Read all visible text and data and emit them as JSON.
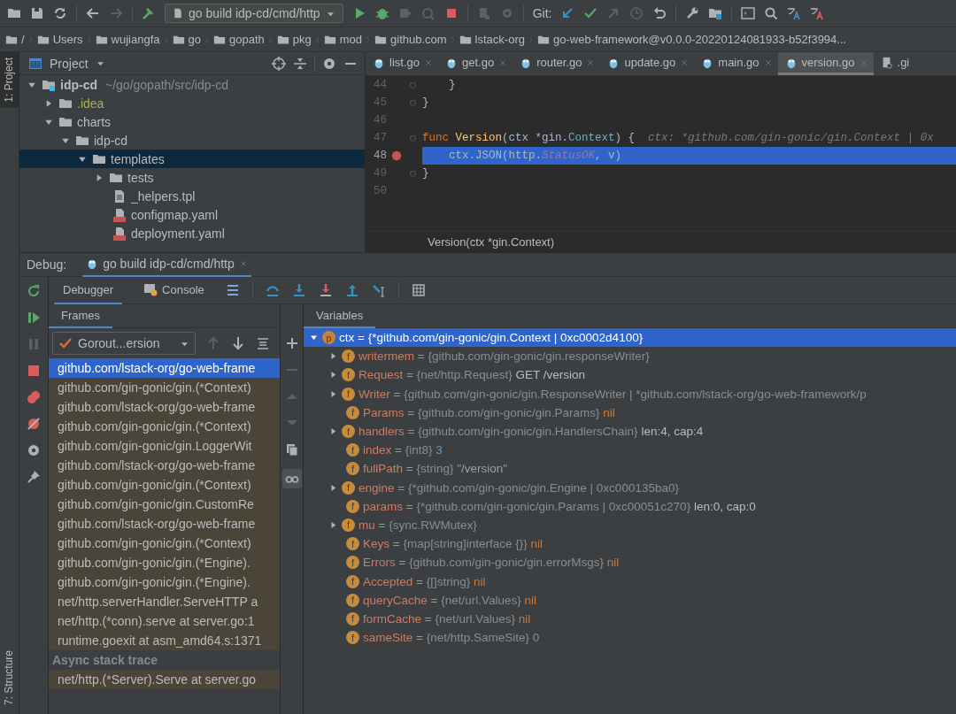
{
  "toolbar": {
    "run_config": "go build idp-cd/cmd/http",
    "git_label": "Git:"
  },
  "breadcrumbs": [
    "/",
    "Users",
    "wujiangfa",
    "go",
    "gopath",
    "pkg",
    "mod",
    "github.com",
    "lstack-org",
    "go-web-framework@v0.0.0-20220124081933-b52f3994..."
  ],
  "tool_strip": {
    "top": "1: Project",
    "bottom": "7: Structure"
  },
  "project": {
    "title": "Project",
    "tree": [
      {
        "name": "idp-cd",
        "hint": "~/go/gopath/src/idp-cd",
        "kind": "module",
        "expanded": true,
        "selected": false,
        "children": [
          {
            "name": ".idea",
            "kind": "folder",
            "expanded": false,
            "selected": false,
            "vcs_ignored": true
          },
          {
            "name": "charts",
            "kind": "folder",
            "expanded": true,
            "selected": false,
            "children": [
              {
                "name": "idp-cd",
                "kind": "folder",
                "expanded": true,
                "selected": false,
                "children": [
                  {
                    "name": "templates",
                    "kind": "folder",
                    "expanded": true,
                    "selected": true,
                    "children": [
                      {
                        "name": "tests",
                        "kind": "folder",
                        "expanded": false,
                        "selected": false
                      },
                      {
                        "name": "_helpers.tpl",
                        "kind": "file",
                        "selected": false
                      },
                      {
                        "name": "configmap.yaml",
                        "kind": "yaml",
                        "selected": false
                      },
                      {
                        "name": "deployment.yaml",
                        "kind": "yaml",
                        "selected": false
                      }
                    ]
                  }
                ]
              }
            ]
          }
        ]
      }
    ]
  },
  "editor": {
    "tabs": [
      {
        "label": "list.go",
        "selected": false
      },
      {
        "label": "get.go",
        "selected": false
      },
      {
        "label": "router.go",
        "selected": false
      },
      {
        "label": "update.go",
        "selected": false
      },
      {
        "label": "main.go",
        "selected": false
      },
      {
        "label": "version.go",
        "selected": true
      },
      {
        "label": ".gi",
        "selected": false,
        "kind": "git"
      }
    ],
    "lines": [
      {
        "number": "44",
        "breakpoint": false,
        "current": false,
        "fold": true,
        "tokens": [
          {
            "text": "    }",
            "kind": "plain"
          }
        ]
      },
      {
        "number": "45",
        "breakpoint": false,
        "current": false,
        "fold": true,
        "tokens": [
          {
            "text": "}",
            "kind": "plain"
          }
        ]
      },
      {
        "number": "46",
        "breakpoint": false,
        "current": false,
        "fold": false
      },
      {
        "number": "47",
        "breakpoint": false,
        "current": false,
        "fold": true,
        "tokens": [
          {
            "text": "func ",
            "kind": "keyword"
          },
          {
            "text": "Version",
            "kind": "function"
          },
          {
            "text": "(ctx *gin.",
            "kind": "plain"
          },
          {
            "text": "Context",
            "kind": "type"
          },
          {
            "text": ") {  ",
            "kind": "plain"
          },
          {
            "text": "ctx: *github.com/gin-gonic/gin.Context | 0x",
            "kind": "hint"
          }
        ]
      },
      {
        "number": "48",
        "breakpoint": true,
        "current": true,
        "fold": false,
        "tokens": [
          {
            "text": "    ctx.JSON(http.",
            "kind": "plain"
          },
          {
            "text": "StatusOK",
            "kind": "const"
          },
          {
            "text": ", v)",
            "kind": "plain"
          }
        ]
      },
      {
        "number": "49",
        "breakpoint": false,
        "current": false,
        "fold": true,
        "tokens": [
          {
            "text": "}",
            "kind": "plain"
          }
        ]
      },
      {
        "number": "50",
        "breakpoint": false,
        "current": false,
        "fold": false
      }
    ],
    "breadcrumb": "Version(ctx *gin.Context)"
  },
  "debug": {
    "label": "Debug:",
    "session": "go build idp-cd/cmd/http",
    "tabs": [
      {
        "label": "Debugger",
        "selected": true
      },
      {
        "label": "Console",
        "selected": false
      }
    ],
    "frames": {
      "title": "Frames",
      "goroutine": "Gorout...ersion",
      "items": [
        {
          "text": "github.com/lstack-org/go-web-frame",
          "selected": true
        },
        {
          "text": "github.com/gin-gonic/gin.(*Context)",
          "selected": false
        },
        {
          "text": "github.com/lstack-org/go-web-frame",
          "selected": false
        },
        {
          "text": "github.com/gin-gonic/gin.(*Context)",
          "selected": false
        },
        {
          "text": "github.com/gin-gonic/gin.LoggerWit",
          "selected": false
        },
        {
          "text": "github.com/lstack-org/go-web-frame",
          "selected": false
        },
        {
          "text": "github.com/gin-gonic/gin.(*Context)",
          "selected": false
        },
        {
          "text": "github.com/gin-gonic/gin.CustomRe",
          "selected": false
        },
        {
          "text": "github.com/lstack-org/go-web-frame",
          "selected": false
        },
        {
          "text": "github.com/gin-gonic/gin.(*Context)",
          "selected": false
        },
        {
          "text": "github.com/gin-gonic/gin.(*Engine).",
          "selected": false
        },
        {
          "text": "github.com/gin-gonic/gin.(*Engine).",
          "selected": false
        },
        {
          "text": "net/http.serverHandler.ServeHTTP a",
          "selected": false
        },
        {
          "text": "net/http.(*conn).serve at server.go:1",
          "selected": false
        },
        {
          "text": "runtime.goexit at asm_amd64.s:1371",
          "selected": false
        }
      ],
      "async_title": "Async stack trace",
      "async_items": [
        {
          "text": "net/http.(*Server).Serve at server.go",
          "selected": false
        }
      ]
    },
    "variables": {
      "title": "Variables",
      "tree": [
        {
          "badge": "p",
          "name": "ctx",
          "op": "=",
          "type": "{*github.com/gin-gonic/gin.Context | 0xc0002d4100}",
          "expanded": true,
          "selected": true,
          "children": [
            {
              "badge": "f",
              "name": "writermem",
              "op": "=",
              "type": "{github.com/gin-gonic/gin.responseWriter}",
              "expanded": false,
              "selected": false
            },
            {
              "badge": "f",
              "name": "Request",
              "op": "=",
              "type": "{net/http.Request}",
              "value": {
                "text": "GET /version",
                "kind": "plain"
              },
              "expanded": false,
              "selected": false
            },
            {
              "badge": "f",
              "name": "Writer",
              "op": "=",
              "type": "{github.com/gin-gonic/gin.ResponseWriter | *github.com/lstack-org/go-web-framework/p",
              "expanded": false,
              "selected": false
            },
            {
              "badge": "f",
              "name": "Params",
              "op": "=",
              "type": "{github.com/gin-gonic/gin.Params}",
              "value": {
                "text": "nil",
                "kind": "nil"
              },
              "selected": false
            },
            {
              "badge": "f",
              "name": "handlers",
              "op": "=",
              "type": "{github.com/gin-gonic/gin.HandlersChain}",
              "value": {
                "text": "len:4, cap:4",
                "kind": "plain"
              },
              "expanded": false,
              "selected": false
            },
            {
              "badge": "f",
              "name": "index",
              "op": "=",
              "type": "{int8}",
              "value": {
                "text": "3",
                "kind": "number"
              },
              "selected": false
            },
            {
              "badge": "f",
              "name": "fullPath",
              "op": "=",
              "type": "{string}",
              "value": {
                "text": "\"/version\"",
                "kind": "string"
              },
              "selected": false
            },
            {
              "badge": "f",
              "name": "engine",
              "op": "=",
              "type": "{*github.com/gin-gonic/gin.Engine | 0xc000135ba0}",
              "expanded": false,
              "selected": false
            },
            {
              "badge": "f",
              "name": "params",
              "op": "=",
              "type": "{*github.com/gin-gonic/gin.Params | 0xc00051c270}",
              "value": {
                "text": "len:0, cap:0",
                "kind": "plain"
              },
              "selected": false
            },
            {
              "badge": "f",
              "name": "mu",
              "op": "=",
              "type": "{sync.RWMutex}",
              "expanded": false,
              "selected": false
            },
            {
              "badge": "f",
              "name": "Keys",
              "op": "=",
              "type": "{map[string]interface {}}",
              "value": {
                "text": "nil",
                "kind": "nil"
              },
              "selected": false
            },
            {
              "badge": "f",
              "name": "Errors",
              "op": "=",
              "type": "{github.com/gin-gonic/gin.errorMsgs}",
              "value": {
                "text": "nil",
                "kind": "nil"
              },
              "selected": false
            },
            {
              "badge": "f",
              "name": "Accepted",
              "op": "=",
              "type": "{[]string}",
              "value": {
                "text": "nil",
                "kind": "nil"
              },
              "selected": false
            },
            {
              "badge": "f",
              "name": "queryCache",
              "op": "=",
              "type": "{net/url.Values}",
              "value": {
                "text": "nil",
                "kind": "nil"
              },
              "selected": false
            },
            {
              "badge": "f",
              "name": "formCache",
              "op": "=",
              "type": "{net/url.Values}",
              "value": {
                "text": "nil",
                "kind": "nil"
              },
              "selected": false
            },
            {
              "badge": "f",
              "name": "sameSite",
              "op": "=",
              "type": "{net/http.SameSite}",
              "value": {
                "text": "0",
                "kind": "number"
              },
              "selected": false
            }
          ]
        }
      ]
    }
  }
}
